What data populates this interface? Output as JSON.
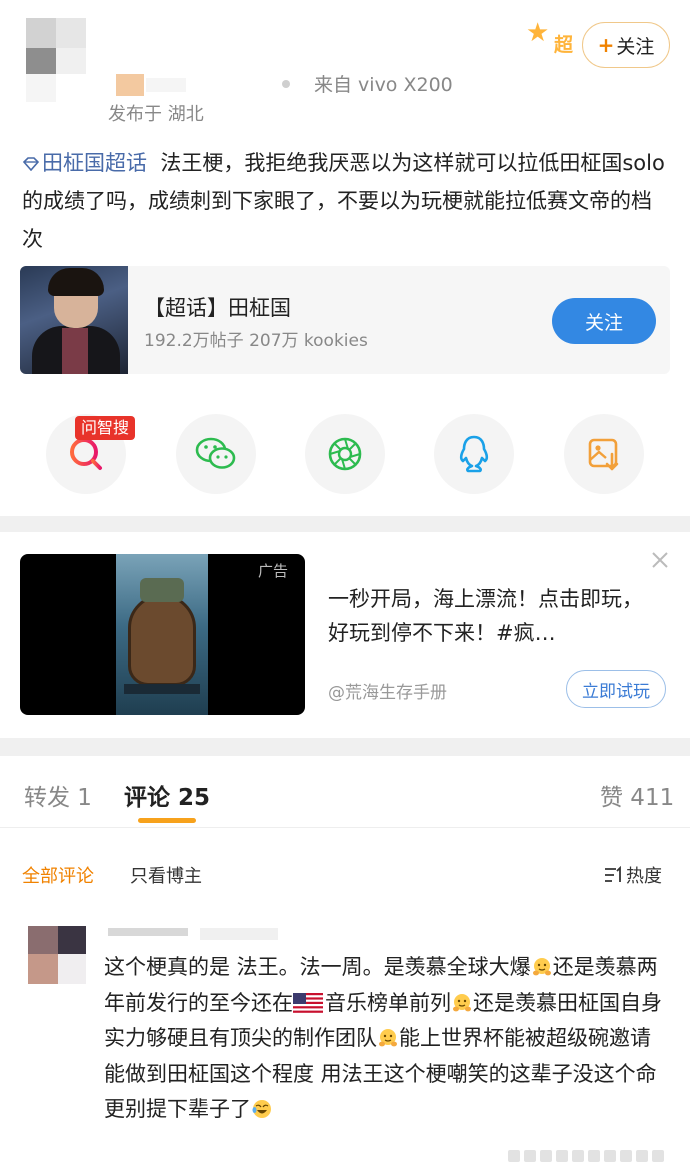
{
  "post": {
    "source": "来自 vivo X200",
    "location": "发布于 湖北",
    "super_badge": "超",
    "follow_label": "关注",
    "topic_link": "田柾国超话",
    "body": "法王梗，我拒绝我厌恶以为这样就可以拉低田柾国solo的成绩了吗，成绩刺到下家眼了，不要以为玩梗就能拉低赛文帝的档次",
    "topic_card": {
      "title": "【超话】田柾国",
      "meta": "192.2万帖子  207万 kookies",
      "follow_label": "关注"
    },
    "share": {
      "ask_badge": "问智搜",
      "buttons": [
        "ask-search-icon",
        "wechat-icon",
        "moments-icon",
        "qq-icon",
        "save-image-icon"
      ]
    }
  },
  "ad": {
    "tag": "广告",
    "text": "一秒开局，海上漂流！点击即玩，好玩到停不下来！#疯…",
    "source": "@荒海生存手册",
    "cta": "立即试玩"
  },
  "tabs": {
    "repost": "转发 1",
    "comments": "评论 25",
    "likes": "赞 411"
  },
  "filter": {
    "all": "全部评论",
    "blogger_only": "只看博主",
    "sort": "热度"
  },
  "comment": {
    "seg1": "这个梗真的是 法王。法一周。是羡慕全球大爆",
    "seg2": "还是羡慕两年前发行的至今还在",
    "seg3": "音乐榜单前列",
    "seg4": "还是羡慕田柾国自身实力够硬且有顶尖的制作团队",
    "seg5": "能上世界杯能被超级碗邀请 能做到田柾国这个程度 用法王这个梗嘲笑的这辈子没这个命 更别提下辈子了"
  },
  "colors": {
    "accent_orange": "#f08200",
    "link_blue": "#496ba9",
    "button_blue": "#3388e3",
    "tab_underline": "#f7a21c",
    "badge_red": "#e8332a"
  }
}
